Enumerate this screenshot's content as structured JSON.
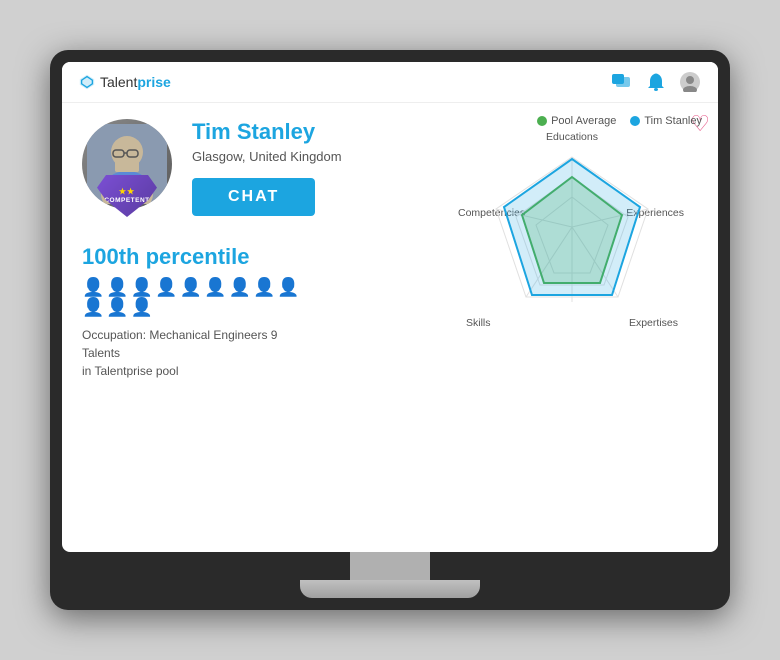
{
  "logo": {
    "talent": "Talent",
    "prise": "prise"
  },
  "nav": {
    "icons": [
      "chat-icon",
      "bell-icon",
      "user-icon"
    ]
  },
  "profile": {
    "name": "Tim Stanley",
    "location": "Glasgow, United Kingdom",
    "chat_button": "CHAT",
    "heart_label": "♡",
    "badge": {
      "stars": "★★",
      "text": "COMPETENT"
    }
  },
  "legend": {
    "pool_average": "Pool Average",
    "tim_stanley": "Tim Stanley",
    "pool_color": "#4caf50",
    "tim_color": "#1ca5e0"
  },
  "radar": {
    "labels": {
      "top": "Educations",
      "right": "Experiences",
      "bottom_right": "Expertises",
      "bottom_left": "Skills",
      "left": "Competencies"
    }
  },
  "stats": {
    "percentile": "100th percentile",
    "occupation": "Occupation: Mechanical Engineers 9 Talents\nin Talentprise pool",
    "person_count": 12
  }
}
